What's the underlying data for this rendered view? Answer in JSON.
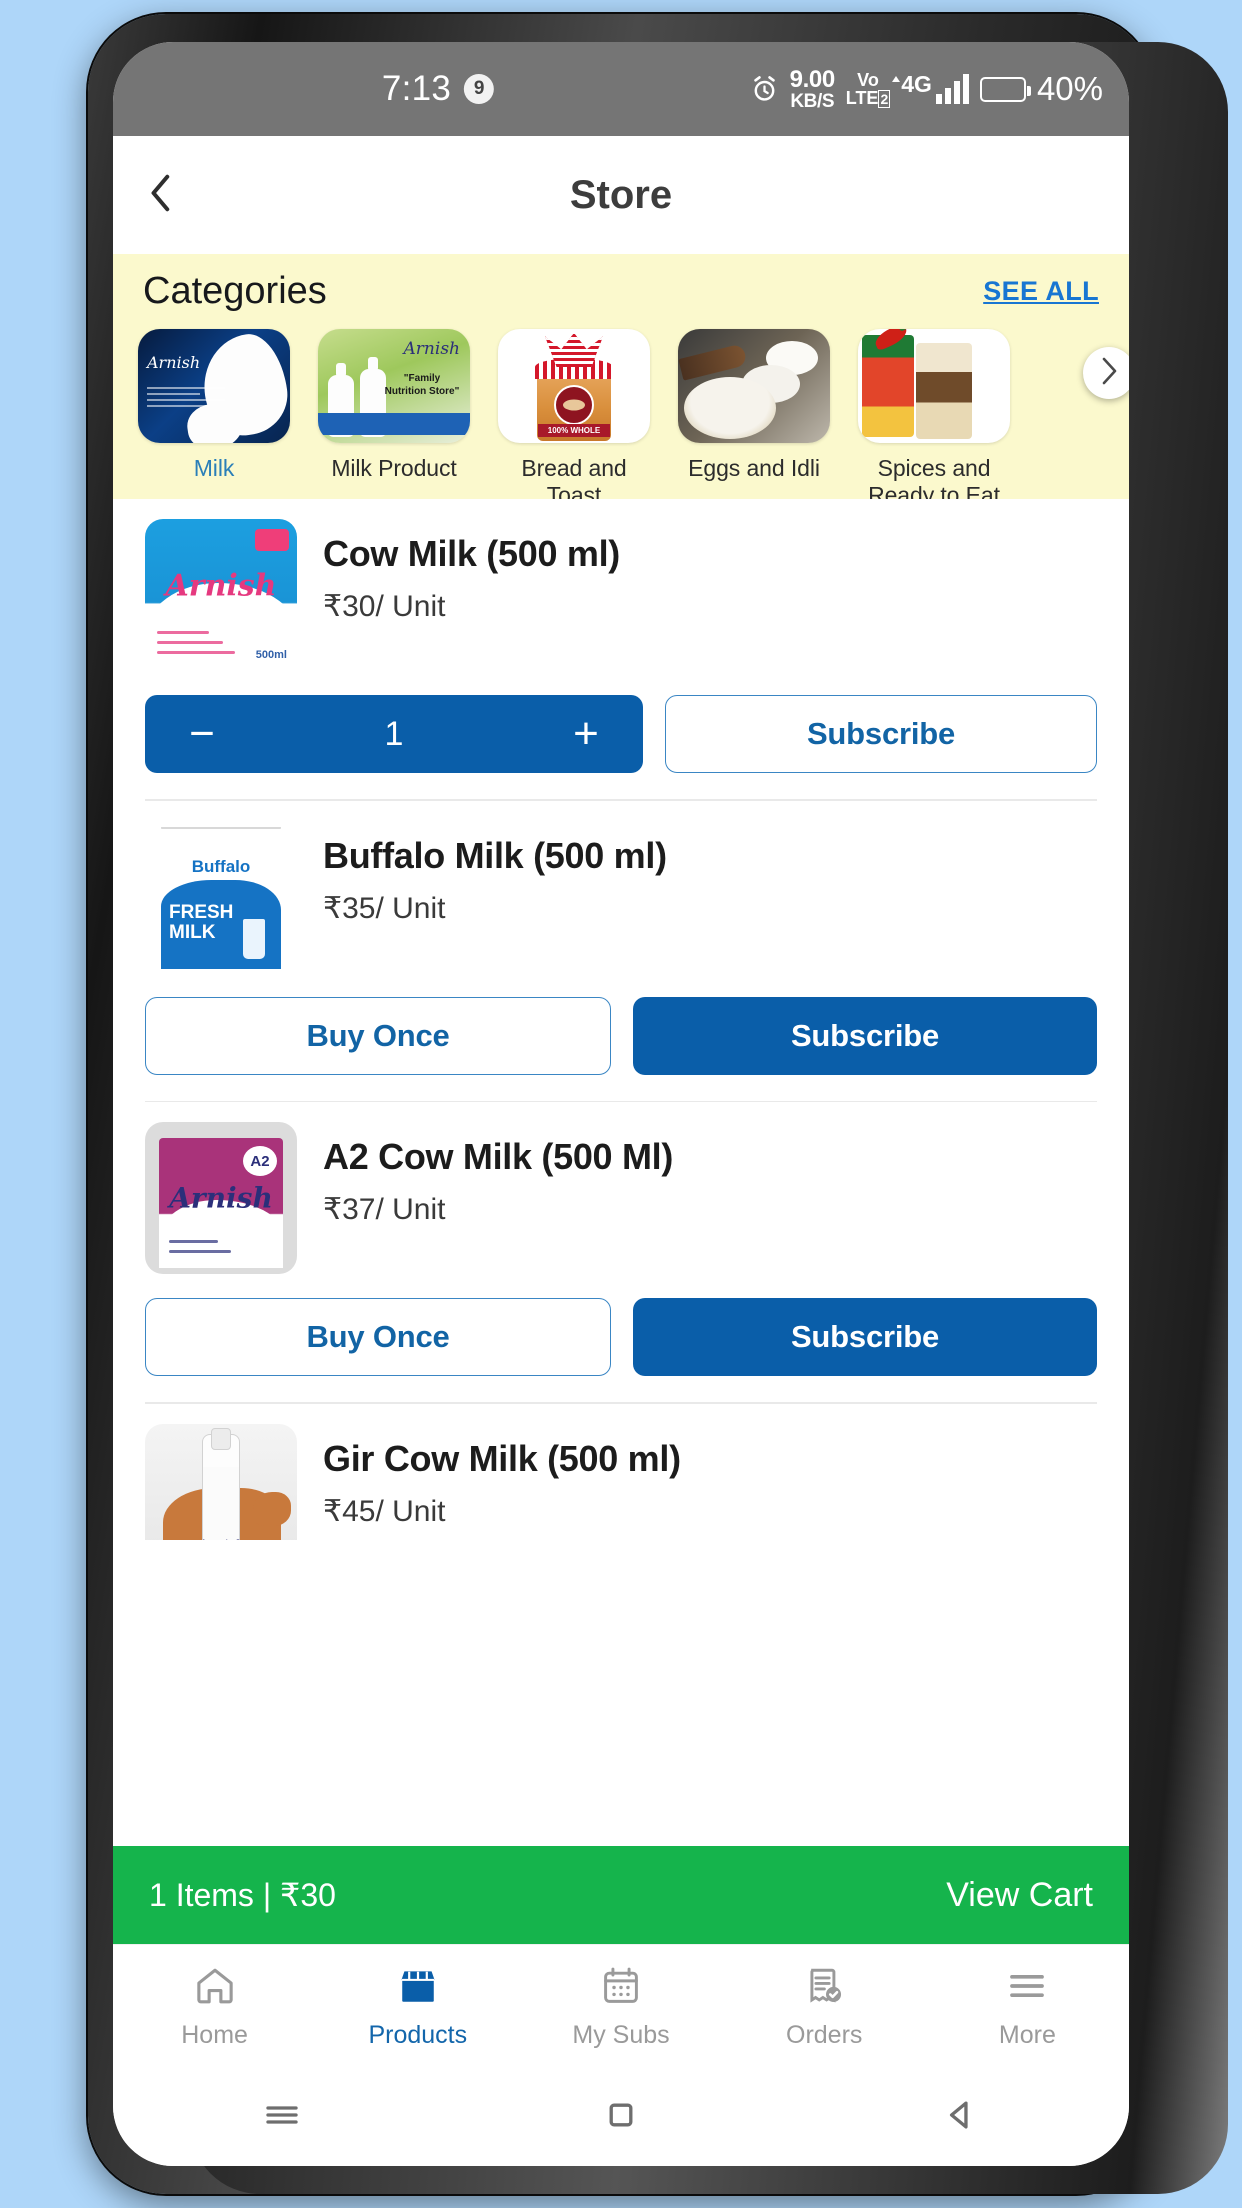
{
  "status_bar": {
    "time": "7:13",
    "notification_count": "9",
    "alarm_icon": "alarm-clock-icon",
    "net_speed_value": "9.00",
    "net_speed_unit": "KB/S",
    "volte_top": "Vo",
    "volte_bottom": "LTE",
    "volte_sim": "2",
    "network_type": "4G",
    "battery_percent": "40%",
    "battery_level": 40
  },
  "app_bar": {
    "back_icon": "chevron-left-icon",
    "title": "Store"
  },
  "categories": {
    "heading": "Categories",
    "see_all": "SEE ALL",
    "next_icon": "chevron-right-icon",
    "items": [
      {
        "label": "Milk",
        "active": true
      },
      {
        "label": "Milk Product",
        "active": false
      },
      {
        "label": "Bread and Toast",
        "active": false
      },
      {
        "label": "Eggs and Idli",
        "active": false
      },
      {
        "label": "Spices and Ready to Eat",
        "active": false
      }
    ]
  },
  "products": [
    {
      "name": "Cow Milk (500 ml)",
      "price": "₹30/ Unit",
      "mode": "stepper",
      "quantity": "1",
      "minus_label": "−",
      "plus_label": "+",
      "secondary_label": "Subscribe"
    },
    {
      "name": "Buffalo Milk (500 ml)",
      "price": "₹35/ Unit",
      "mode": "buttons",
      "primary_label": "Buy Once",
      "secondary_label": "Subscribe"
    },
    {
      "name": "A2 Cow Milk (500 Ml)",
      "price": "₹37/ Unit",
      "mode": "buttons",
      "primary_label": "Buy Once",
      "secondary_label": "Subscribe"
    },
    {
      "name": "Gir Cow Milk (500 ml)",
      "price": "₹45/ Unit",
      "mode": "none"
    }
  ],
  "cart_bar": {
    "summary": "1 Items | ₹30",
    "action": "View Cart"
  },
  "bottom_nav": [
    {
      "label": "Home",
      "icon": "home-icon",
      "active": false
    },
    {
      "label": "Products",
      "icon": "store-icon",
      "active": true
    },
    {
      "label": "My Subs",
      "icon": "calendar-icon",
      "active": false
    },
    {
      "label": "Orders",
      "icon": "receipt-check-icon",
      "active": false
    },
    {
      "label": "More",
      "icon": "hamburger-menu-icon",
      "active": false
    }
  ],
  "system_nav": {
    "recents_icon": "recents-icon",
    "home_icon": "home-square-icon",
    "back_icon": "back-triangle-icon"
  },
  "colors": {
    "brand_blue": "#0a5ea9",
    "cart_green": "#15b44c",
    "categories_bg": "#fbf9cd",
    "link_blue": "#1876d2"
  }
}
